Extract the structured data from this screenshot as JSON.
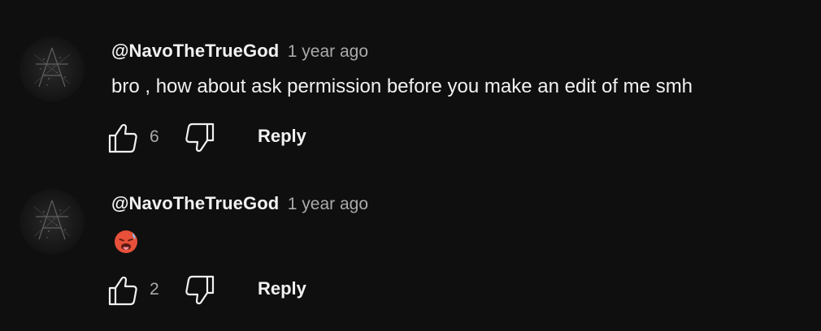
{
  "comments": [
    {
      "author": "@NavoTheTrueGod",
      "time": "1 year ago",
      "text": "bro , how about ask permission before you make an edit of me smh",
      "like_count": "6",
      "reply_label": "Reply"
    },
    {
      "author": "@NavoTheTrueGod",
      "time": "1 year ago",
      "text": "🥵",
      "like_count": "2",
      "reply_label": "Reply"
    }
  ],
  "icons": {
    "like": "thumbs-up-icon",
    "dislike": "thumbs-down-icon",
    "avatar": "user-avatar"
  },
  "colors": {
    "background": "#0f0f0f",
    "primary_text": "#f1f1f1",
    "secondary_text": "#aaaaaa"
  }
}
